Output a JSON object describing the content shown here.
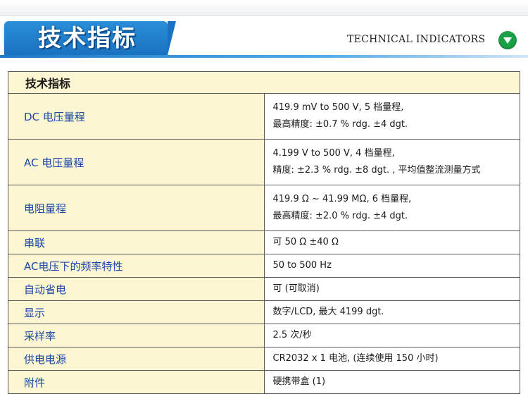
{
  "header": {
    "banner_title": "技术指标",
    "en_title": "TECHNICAL INDICATORS",
    "icon": "chevron-down-circle-icon",
    "accent_color": "#1a72c0",
    "icon_color": "#1aa046"
  },
  "table": {
    "header_label": "技术指标",
    "label_color": "#1a47a8",
    "label_bg": "#fdf6d2",
    "rows": [
      {
        "label": "DC 电压量程",
        "lines": [
          "419.9 mV to 500 V, 5 档量程,",
          "最高精度: ±0.7 % rdg. ±4 dgt."
        ]
      },
      {
        "label": "AC 电压量程",
        "lines": [
          "4.199 V to 500 V, 4 档量程,",
          "精度: ±2.3 % rdg. ±8 dgt. , 平均值整流测量方式"
        ]
      },
      {
        "label": "电阻量程",
        "lines": [
          "419.9 Ω ~ 41.99 MΩ, 6 档量程,",
          "最高精度: ±2.0 % rdg. ±4 dgt."
        ]
      },
      {
        "label": "串联",
        "lines": [
          "可 50 Ω ±40 Ω"
        ]
      },
      {
        "label": "AC电压下的频率特性",
        "lines": [
          "50 to 500 Hz"
        ]
      },
      {
        "label": "自动省电",
        "lines": [
          "可 (可取消)"
        ]
      },
      {
        "label": "显示",
        "lines": [
          "数字/LCD, 最大 4199 dgt."
        ]
      },
      {
        "label": "采样率",
        "lines": [
          "2.5 次/秒"
        ]
      },
      {
        "label": "供电电源",
        "lines": [
          "CR2032 x 1 电池, (连续使用 150 小时)"
        ]
      },
      {
        "label": "附件",
        "lines": [
          "硬携带盒 (1)"
        ]
      }
    ]
  }
}
